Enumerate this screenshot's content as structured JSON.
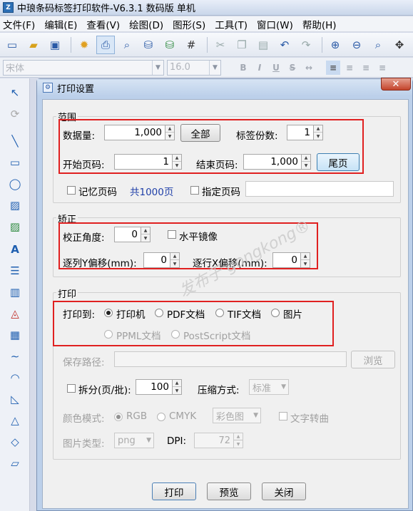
{
  "app": {
    "title": "中琅条码标签打印软件-V6.3.1 数码版 单机"
  },
  "menu": [
    "文件(F)",
    "编辑(E)",
    "查看(V)",
    "绘图(D)",
    "图形(S)",
    "工具(T)",
    "窗口(W)",
    "帮助(H)"
  ],
  "fontbar": {
    "font_name": "宋体",
    "font_size": "16.0"
  },
  "dialog": {
    "title": "打印设置",
    "range": {
      "group_label": "范围",
      "data_qty_label": "数据量:",
      "data_qty": "1,000",
      "all_button": "全部",
      "copies_label": "标签份数:",
      "copies": "1",
      "start_page_label": "开始页码:",
      "start_page": "1",
      "end_page_label": "结束页码:",
      "end_page": "1,000",
      "last_page_button": "尾页",
      "remember_page_label": "记忆页码",
      "total_pages": "共1000页",
      "specify_page_label": "指定页码",
      "specify_page_value": ""
    },
    "correction": {
      "group_label": "矫正",
      "angle_label": "校正角度:",
      "angle": "0",
      "mirror_label": "水平镜像",
      "col_y_offset_label": "逐列Y偏移(mm):",
      "col_y_offset": "0",
      "row_x_offset_label": "逐行X偏移(mm):",
      "row_x_offset": "0"
    },
    "print": {
      "group_label": "打印",
      "print_to_label": "打印到:",
      "options": [
        "打印机",
        "PDF文档",
        "TIF文档",
        "图片",
        "PPML文档",
        "PostScript文档"
      ],
      "selected": "打印机",
      "save_path_label": "保存路径:",
      "save_path": "",
      "browse_button": "浏览",
      "split_label": "拆分(页/批):",
      "split_value": "100",
      "compress_label": "压缩方式:",
      "compress_value": "标准",
      "color_mode_label": "颜色模式:",
      "color_modes": [
        "RGB",
        "CMYK"
      ],
      "color_selected": "RGB",
      "color_type": "彩色图",
      "text_to_curve_label": "文字转曲",
      "image_type_label": "图片类型:",
      "image_type": "png",
      "dpi_label": "DPI:",
      "dpi": "72"
    },
    "buttons": {
      "print": "打印",
      "preview": "预览",
      "close": "关闭"
    }
  },
  "watermark": "发布于 gongkong®",
  "colors": {
    "highlight_box": "#e02020",
    "dialog_frame": "#bcd0ea"
  },
  "icons": [
    "new-file-icon",
    "open-folder-icon",
    "save-icon",
    "settings-icon",
    "print-icon",
    "preview-icon",
    "database-icon",
    "barcode-db-icon",
    "grid-icon",
    "cut-icon",
    "copy-icon",
    "paste-icon",
    "undo-icon",
    "redo-icon",
    "zoom-in-icon",
    "zoom-out-icon",
    "zoom-fit-icon",
    "fullscreen-icon"
  ]
}
